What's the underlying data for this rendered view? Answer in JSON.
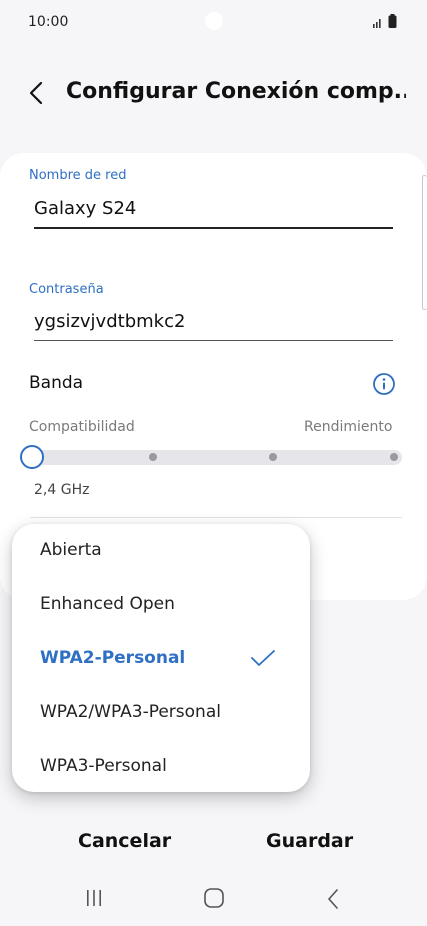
{
  "status_bar": {
    "time": "10:00"
  },
  "header": {
    "title": "Configurar Conexión comp..."
  },
  "network": {
    "name_label": "Nombre de red",
    "name_value": "Galaxy S24",
    "password_label": "Contraseña",
    "password_value": "ygsizvjvdtbmkc2"
  },
  "band": {
    "title": "Banda",
    "left_label": "Compatibilidad",
    "right_label": "Rendimiento",
    "value": "2,4 GHz",
    "slider_position": 0,
    "slider_steps": 4
  },
  "security_menu": {
    "items": [
      {
        "label": "Abierta",
        "selected": false
      },
      {
        "label": "Enhanced Open",
        "selected": false
      },
      {
        "label": "WPA2-Personal",
        "selected": true
      },
      {
        "label": "WPA2/WPA3-Personal",
        "selected": false
      },
      {
        "label": "WPA3-Personal",
        "selected": false
      }
    ]
  },
  "actions": {
    "cancel_label": "Cancelar",
    "save_label": "Guardar"
  },
  "colors": {
    "accent": "#2f6fc4",
    "background": "#f6f6f8",
    "card": "#ffffff"
  },
  "icons": [
    "back-icon",
    "info-icon",
    "check-icon",
    "signal-icon",
    "battery-icon",
    "nav-recent-icon",
    "nav-home-icon",
    "nav-back-icon"
  ]
}
